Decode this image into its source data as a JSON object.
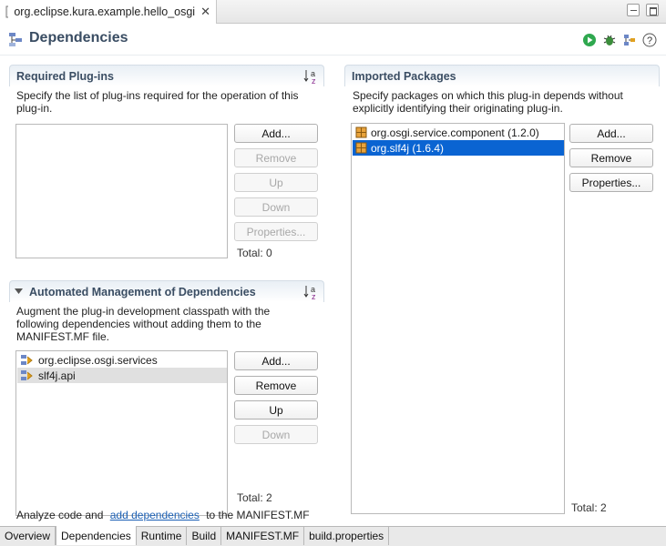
{
  "editor_tab": {
    "label": "org.eclipse.kura.example.hello_osgi",
    "close": "✕"
  },
  "header": {
    "title": "Dependencies"
  },
  "required": {
    "title": "Required Plug-ins",
    "description": "Specify the list of plug-ins required for the operation of this plug-in.",
    "items": [],
    "buttons": {
      "add": "Add...",
      "remove": "Remove",
      "up": "Up",
      "down": "Down",
      "properties": "Properties..."
    },
    "total": "Total: 0"
  },
  "automated": {
    "title": "Automated Management of Dependencies",
    "description": "Augment the plug-in development classpath with the following dependencies without adding them to the MANIFEST.MF file.",
    "items": [
      "org.eclipse.osgi.services",
      "slf4j.api"
    ],
    "buttons": {
      "add": "Add...",
      "remove": "Remove",
      "up": "Up",
      "down": "Down"
    },
    "total": "Total: 2",
    "footer_pre": "Analyze code and",
    "footer_link": "add dependencies",
    "footer_post": "to the MANIFEST.MF"
  },
  "imported": {
    "title": "Imported Packages",
    "description": "Specify packages on which this plug-in depends without explicitly identifying their originating plug-in.",
    "items": [
      "org.osgi.service.component (1.2.0)",
      "org.slf4j (1.6.4)"
    ],
    "buttons": {
      "add": "Add...",
      "remove": "Remove",
      "properties": "Properties..."
    },
    "total": "Total: 2"
  },
  "bottom_tabs": [
    "Overview",
    "Dependencies",
    "Runtime",
    "Build",
    "MANIFEST.MF",
    "build.properties"
  ],
  "colors": {
    "selection": "#0a64d2",
    "section_title": "#3a4d63",
    "link": "#1a5fb4"
  },
  "icons": {
    "sort": "sort-az-icon",
    "run": "run-icon",
    "debug": "debug-icon",
    "export": "export-icon",
    "help": "help-icon"
  }
}
